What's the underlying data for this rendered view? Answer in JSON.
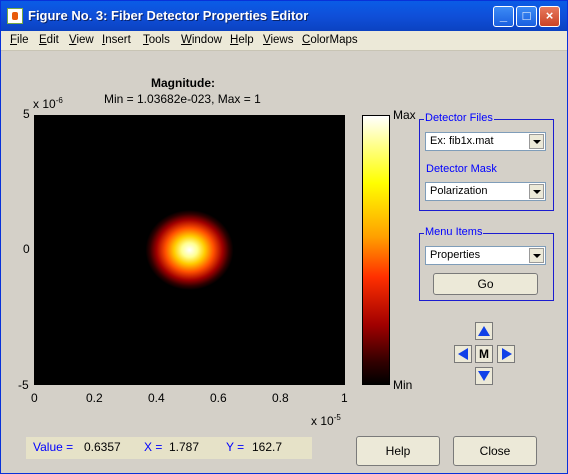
{
  "window": {
    "title": "Figure No. 3: Fiber Detector Properties Editor"
  },
  "menu": [
    "File",
    "Edit",
    "View",
    "Insert",
    "Tools",
    "Window",
    "Help",
    "Views",
    "ColorMaps"
  ],
  "plot": {
    "title_line1": "Magnitude:",
    "title_line2": "Min = 1.03682e-023, Max = 1",
    "y_exponent": "x 10",
    "y_exponent_power": "-6",
    "x_exponent": "x 10",
    "x_exponent_power": "-5",
    "y_ticks": [
      "5",
      "0",
      "-5"
    ],
    "x_ticks": [
      "0",
      "0.2",
      "0.4",
      "0.6",
      "0.8",
      "1"
    ],
    "colorbar_max": "Max",
    "colorbar_min": "Min"
  },
  "chart_data": {
    "type": "heatmap",
    "title": "Magnitude:",
    "subtitle": "Min = 1.03682e-023, Max = 1",
    "colormap": [
      "#000000",
      "#a00000",
      "#ff3000",
      "#ffa000",
      "#ffff00",
      "#ffffff"
    ],
    "xlim": [
      0,
      1e-05
    ],
    "ylim": [
      -5e-06,
      5e-06
    ],
    "peak": {
      "x": 5e-06,
      "y": 0,
      "value": 1
    }
  },
  "detector_files": {
    "label": "Detector Files",
    "selected": "Ex: fib1x.mat",
    "mask_label": "Detector Mask",
    "mask_selected": "Polarization"
  },
  "menu_items": {
    "label": "Menu Items",
    "selected": "Properties",
    "go": "Go"
  },
  "nav": {
    "center": "M"
  },
  "status": {
    "value_label": "Value =",
    "value": "0.6357",
    "x_label": "X =",
    "x": "1.787",
    "y_label": "Y =",
    "y": "162.7"
  },
  "buttons": {
    "help": "Help",
    "close": "Close"
  },
  "colors": {
    "accent": "#0000ff",
    "nav_blue": "#1040e8"
  }
}
